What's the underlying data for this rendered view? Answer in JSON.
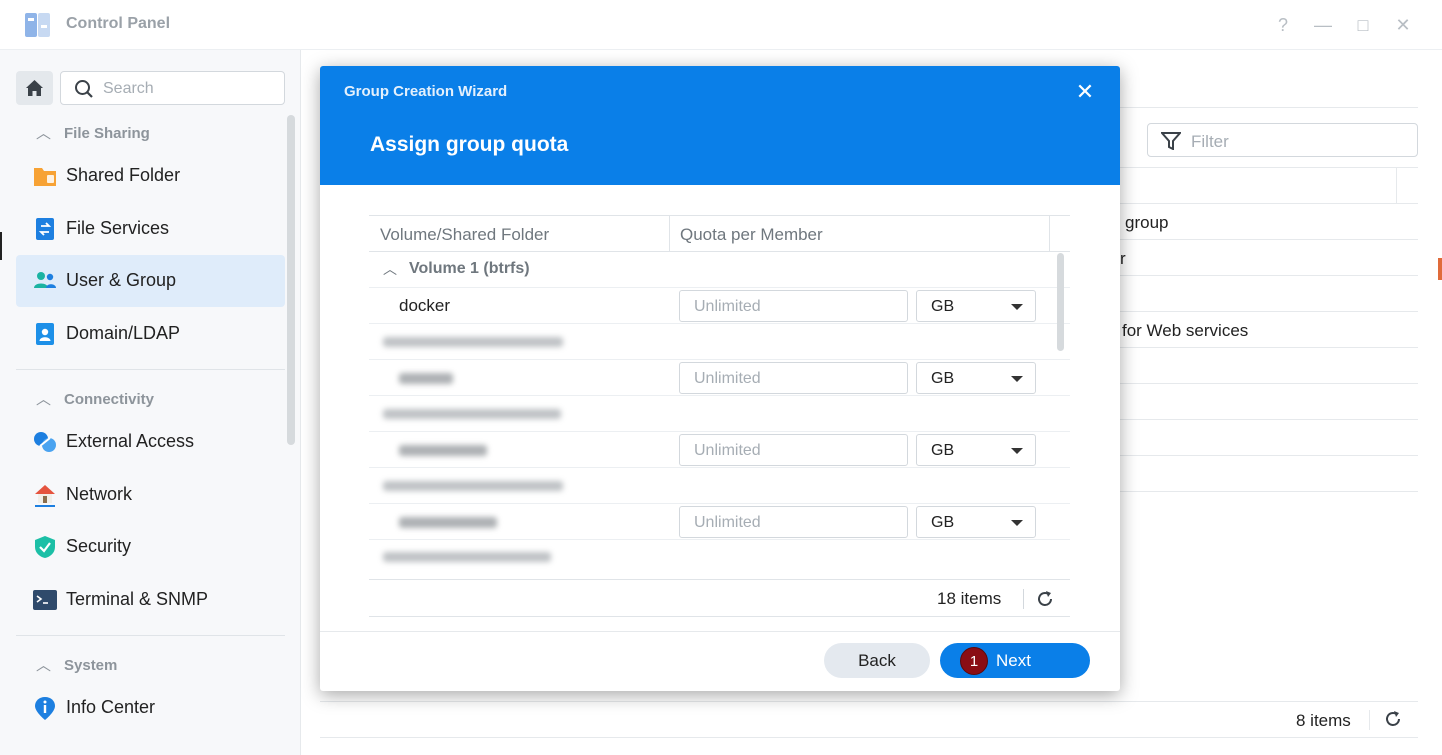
{
  "window": {
    "title": "Control Panel",
    "help": "?",
    "minimize": "—",
    "maximize": "□",
    "close": "✕"
  },
  "sidebar": {
    "search_placeholder": "Search",
    "sections": [
      {
        "title": "File Sharing",
        "items": [
          {
            "label": "Shared Folder"
          },
          {
            "label": "File Services"
          },
          {
            "label": "User & Group",
            "active": true
          },
          {
            "label": "Domain/LDAP"
          }
        ]
      },
      {
        "title": "Connectivity",
        "items": [
          {
            "label": "External Access"
          },
          {
            "label": "Network"
          },
          {
            "label": "Security"
          },
          {
            "label": "Terminal & SNMP"
          }
        ]
      },
      {
        "title": "System",
        "items": [
          {
            "label": "Info Center"
          }
        ]
      }
    ]
  },
  "background": {
    "filter_placeholder": "Filter",
    "row_fragments": [
      "group",
      "r",
      "for Web services"
    ],
    "items_count": "8 items"
  },
  "dialog": {
    "title": "Group Creation Wizard",
    "step_title": "Assign group quota",
    "columns": [
      "Volume/Shared Folder",
      "Quota per Member"
    ],
    "group": {
      "label": "Volume 1 (btrfs)"
    },
    "rows": [
      {
        "folder": "docker",
        "placeholder": "Unlimited",
        "unit": "GB"
      },
      {
        "placeholder": "Unlimited",
        "unit": "GB"
      },
      {
        "placeholder": "Unlimited",
        "unit": "GB"
      },
      {
        "placeholder": "Unlimited",
        "unit": "GB"
      }
    ],
    "items_count": "18 items",
    "back_label": "Back",
    "next_label": "Next",
    "badge": "1"
  },
  "colors": {
    "accent": "#0a7fe8",
    "badge": "#8a0d14"
  }
}
